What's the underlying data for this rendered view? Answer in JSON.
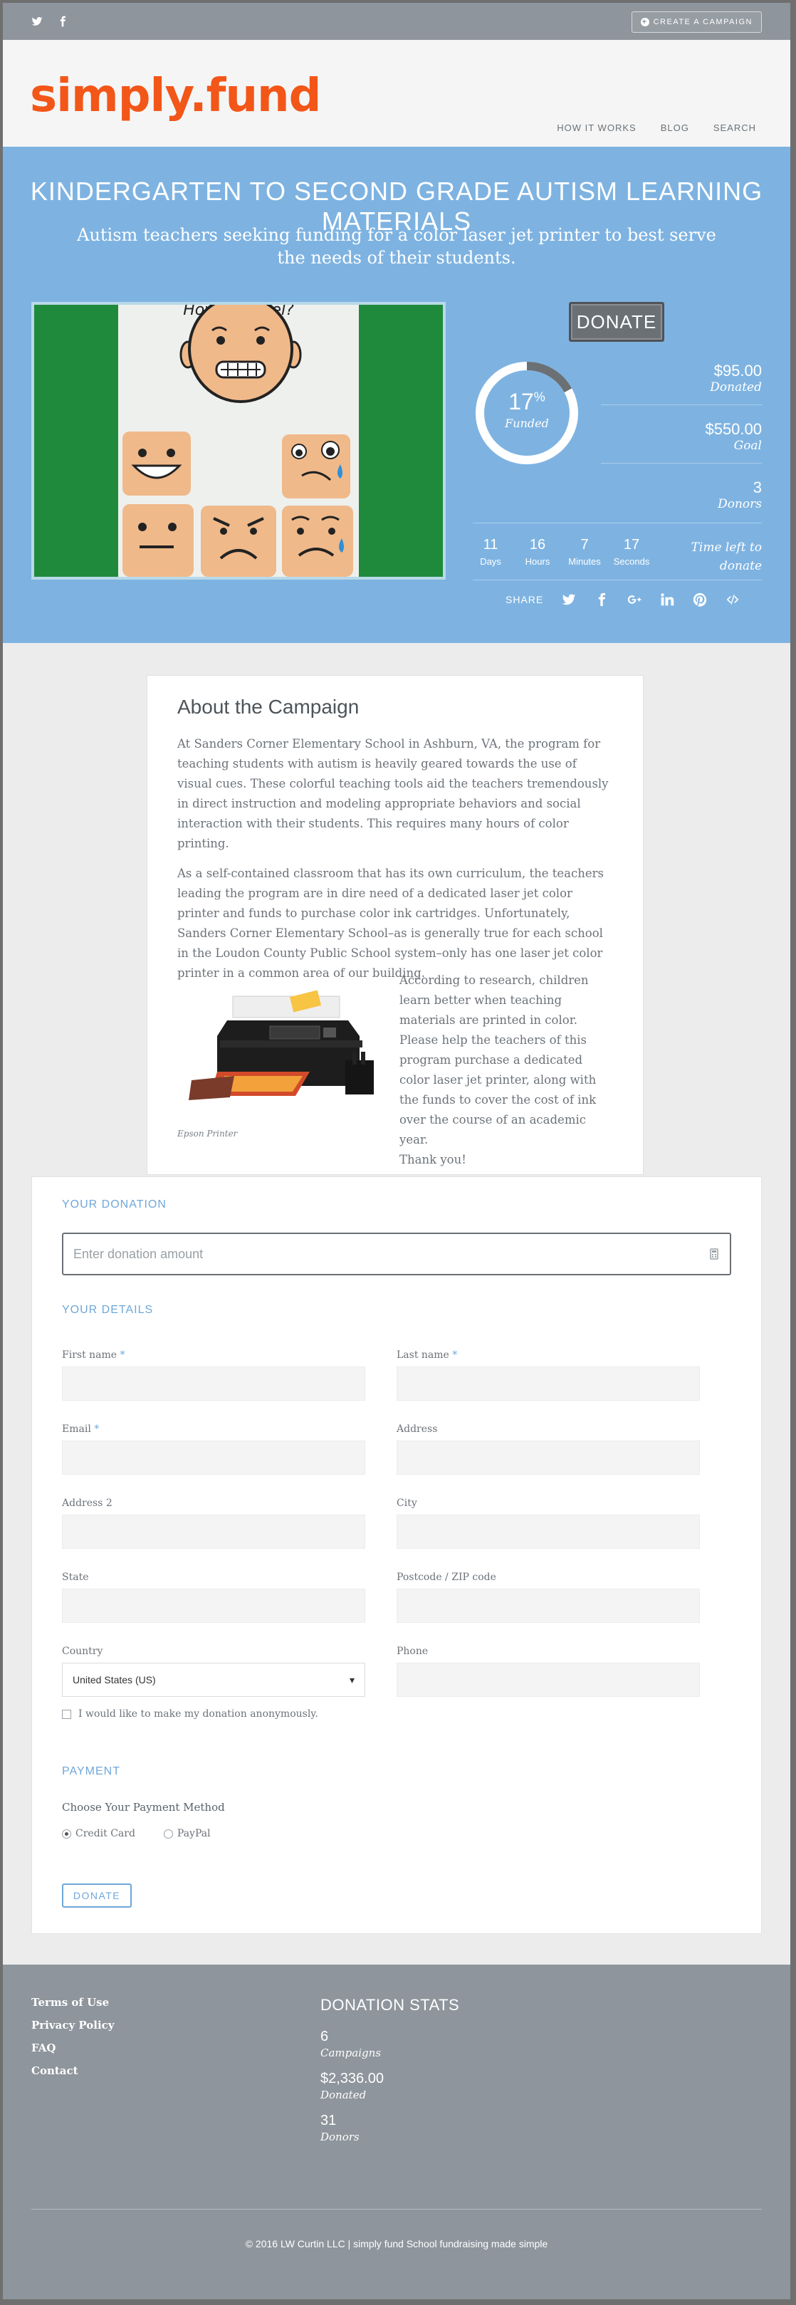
{
  "topbar": {
    "create_label": "CREATE A CAMPAIGN"
  },
  "header": {
    "logo": "simply.fund",
    "nav": [
      "HOW IT WORKS",
      "BLOG",
      "SEARCH"
    ]
  },
  "campaign": {
    "title": "KINDERGARTEN TO SECOND GRADE AUTISM LEARNING MATERIALS",
    "subtitle": "Autism teachers seeking funding for a color laser jet printer to best serve the needs of their students.",
    "image_heading": "How do I feel?",
    "donate_label": "DONATE",
    "funded_percent": "17",
    "funded_symbol": "%",
    "funded_label": "Funded",
    "funded_fraction": 0.17,
    "donated_value": "$95.00",
    "donated_label": "Donated",
    "goal_value": "$550.00",
    "goal_label": "Goal",
    "donors_value": "3",
    "donors_label": "Donors",
    "countdown": {
      "days": "11",
      "days_label": "Days",
      "hours": "16",
      "hours_label": "Hours",
      "minutes": "7",
      "minutes_label": "Minutes",
      "seconds": "17",
      "seconds_label": "Seconds"
    },
    "time_left_label": "Time left to donate",
    "share_label": "SHARE"
  },
  "about": {
    "heading": "About the Campaign",
    "p1": "At Sanders Corner Elementary School in Ashburn, VA, the program for teaching students with autism is heavily geared towards the use of visual cues. These colorful teaching tools aid the teachers tremendously in direct instruction and modeling appropriate behaviors and social interaction with their students. This requires many hours of color printing.",
    "p2": "As a self-contained classroom that has its own curriculum, the teachers leading the program are in dire need of a dedicated laser jet color printer and funds to purchase color ink cartridges. Unfortunately, Sanders Corner Elementary School–as is generally true for each school in the Loudon County Public School system–only has one laser jet color printer in a common area of our building.",
    "p3": "According to research, children learn better when teaching materials are printed in color. Please help the teachers of this program purchase a dedicated color laser jet printer, along with the funds to cover the cost of ink over the course of an academic year.",
    "p4": "Thank you!",
    "image_caption": "Epson Printer"
  },
  "form": {
    "your_donation": "YOUR DONATION",
    "amount_placeholder": "Enter donation amount",
    "your_details": "YOUR DETAILS",
    "first_name": "First name",
    "last_name": "Last name",
    "email": "Email",
    "address": "Address",
    "address2": "Address 2",
    "city": "City",
    "state": "State",
    "postcode": "Postcode / ZIP code",
    "country": "Country",
    "phone": "Phone",
    "country_value": "United States (US)",
    "required_mark": "*",
    "anonymous_label": "I would like to make my donation anonymously.",
    "payment": "PAYMENT",
    "choose_method": "Choose Your Payment Method",
    "credit_card": "Credit Card",
    "paypal": "PayPal",
    "donate_label": "DONATE"
  },
  "footer": {
    "links": [
      "Terms of Use",
      "Privacy Policy",
      "FAQ",
      "Contact"
    ],
    "stats_heading": "DONATION STATS",
    "campaigns_value": "6",
    "campaigns_label": "Campaigns",
    "donated_value": "$2,336.00",
    "donated_label": "Donated",
    "donors_value": "31",
    "donors_label": "Donors",
    "copyright": "© 2016 LW Curtin LLC | simply fund  School fundraising made simple"
  },
  "colors": {
    "accent": "#f25618",
    "hero": "#7eb3e1",
    "footer": "#8e959c",
    "link": "#6fa7d9"
  }
}
